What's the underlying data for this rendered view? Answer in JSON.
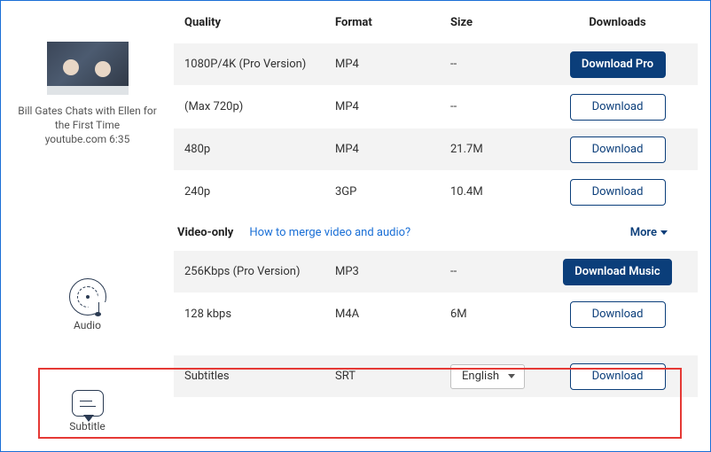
{
  "video": {
    "title": "Bill Gates Chats with Ellen for the First Time",
    "source_line": "youtube.com 6:35"
  },
  "headers": {
    "quality": "Quality",
    "format": "Format",
    "size": "Size",
    "downloads": "Downloads"
  },
  "rows": [
    {
      "quality": "1080P/4K (Pro Version)",
      "format": "MP4",
      "size": "--",
      "button": "Download Pro",
      "style": "solid"
    },
    {
      "quality": "(Max 720p)",
      "format": "MP4",
      "size": "--",
      "button": "Download",
      "style": "outline"
    },
    {
      "quality": "480p",
      "format": "MP4",
      "size": "21.7M",
      "button": "Download",
      "style": "outline"
    },
    {
      "quality": "240p",
      "format": "3GP",
      "size": "10.4M",
      "button": "Download",
      "style": "outline"
    }
  ],
  "video_only": {
    "title": "Video-only",
    "help_link": "How to merge video and audio?",
    "more": "More"
  },
  "audio_section": {
    "label": "Audio"
  },
  "audio_rows": [
    {
      "quality": "256Kbps (Pro Version)",
      "format": "MP3",
      "size": "--",
      "button": "Download Music",
      "style": "solid"
    },
    {
      "quality": "128 kbps",
      "format": "M4A",
      "size": "6M",
      "button": "Download",
      "style": "outline"
    }
  ],
  "subtitle_section": {
    "label": "Subtitle"
  },
  "subtitle_row": {
    "quality": "Subtitles",
    "format": "SRT",
    "lang_selected": "English",
    "button": "Download",
    "style": "outline"
  }
}
